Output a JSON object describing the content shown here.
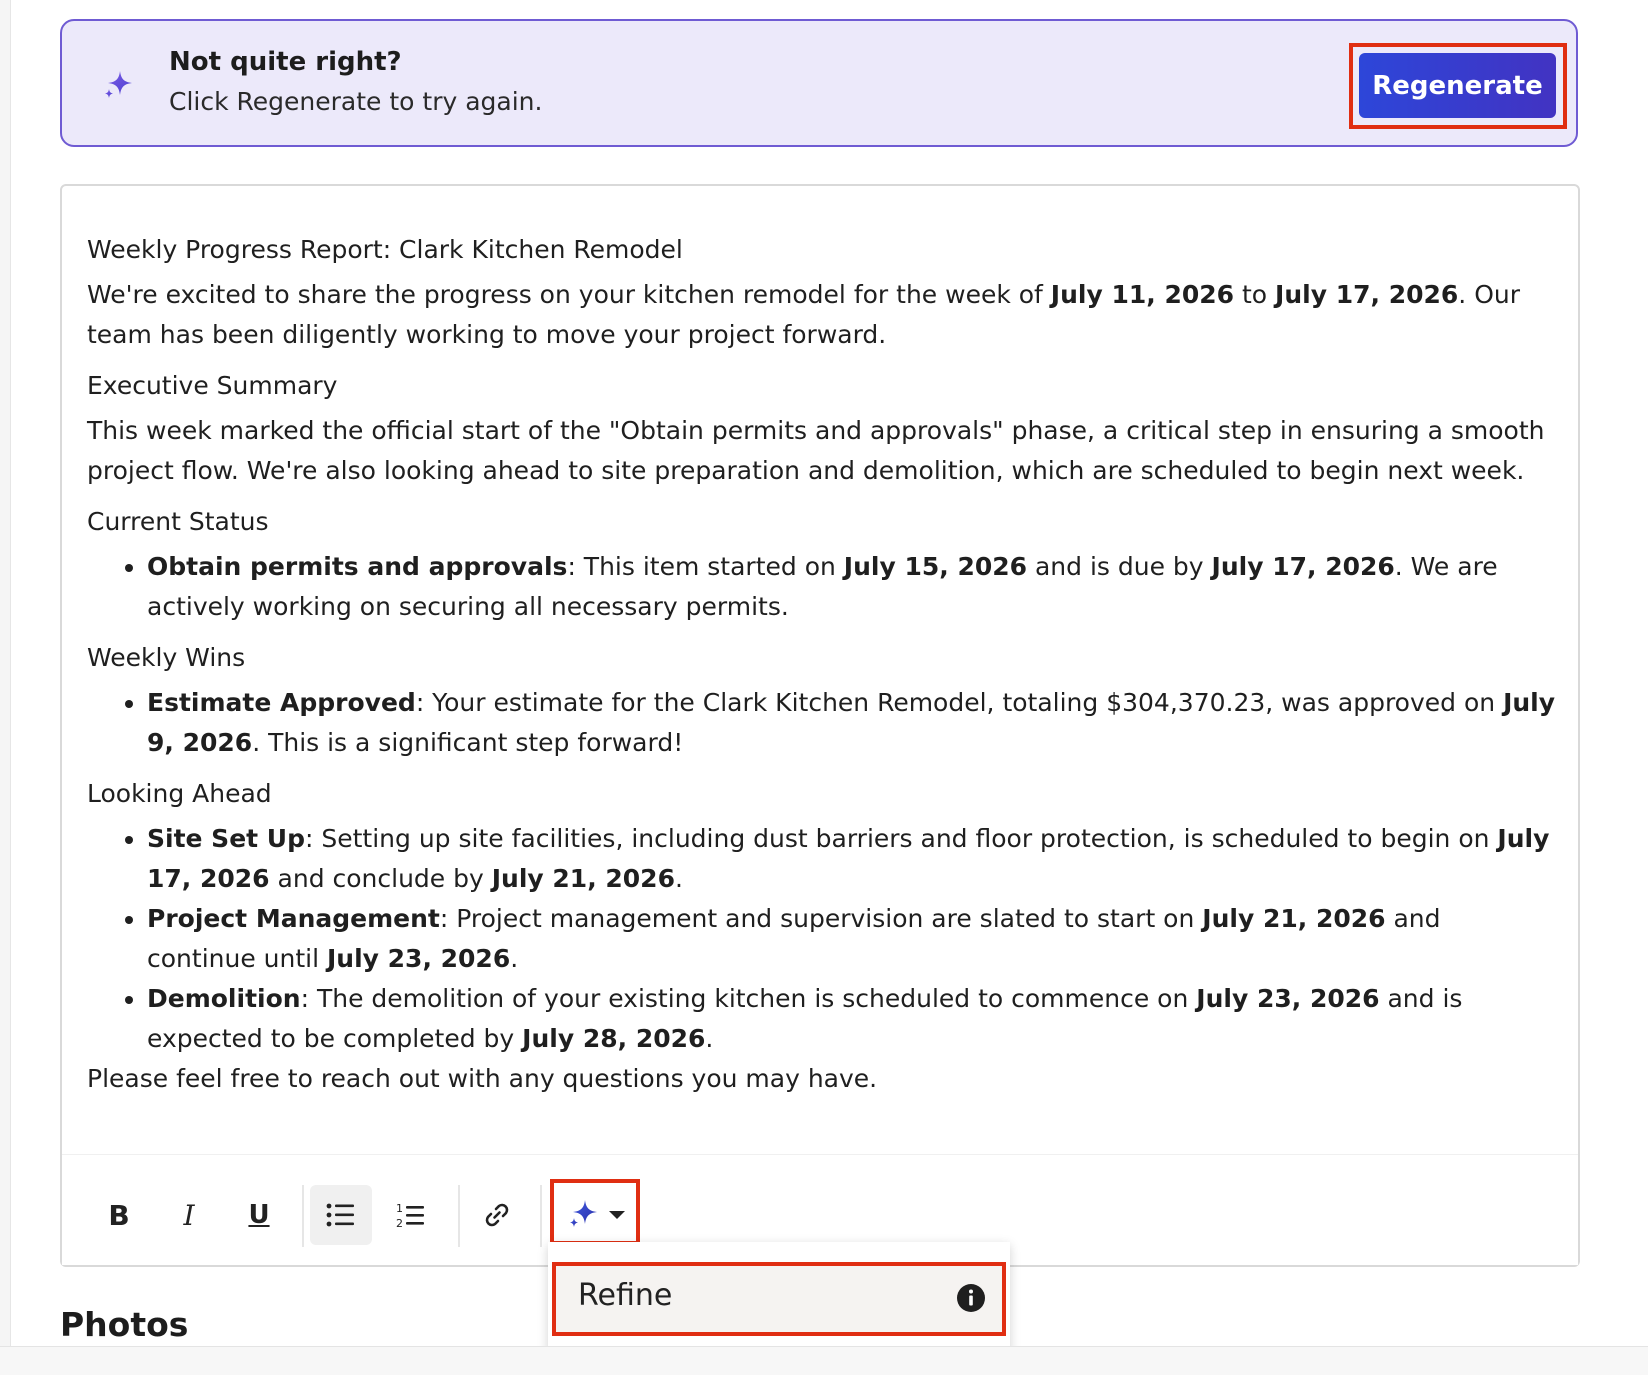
{
  "banner": {
    "title": "Not quite right?",
    "subtitle": "Click Regenerate to try again.",
    "regenerate_label": "Regenerate",
    "icon": "sparkle-icon"
  },
  "report": {
    "title": "Weekly Progress Report: Clark Kitchen Remodel",
    "intro": {
      "p1": "We're excited to share the progress on your kitchen remodel for the week of ",
      "date_start": "July 11, 2026",
      "p2": " to ",
      "date_end": "July 17, 2026",
      "p3": ". Our team has been diligently working to move your project forward."
    },
    "exec_summary": {
      "heading": "Executive Summary",
      "text": "This week marked the official start of the \"Obtain permits and approvals\" phase, a critical step in ensuring a smooth project flow. We're also looking ahead to site preparation and demolition, which are scheduled to begin next week."
    },
    "current_status": {
      "heading": "Current Status",
      "item": {
        "label": "Obtain permits and approvals",
        "t1": ": This item started on ",
        "d1": "July 15, 2026",
        "t2": " and is due by ",
        "d2": "July 17, 2026",
        "t3": ". We are actively working on securing all necessary permits."
      }
    },
    "weekly_wins": {
      "heading": "Weekly Wins",
      "item": {
        "label": "Estimate Approved",
        "t1": ": Your estimate for the Clark Kitchen Remodel, totaling $304,370.23, was approved on ",
        "d1": "July 9, 2026",
        "t2": ". This is a significant step forward!"
      }
    },
    "looking_ahead": {
      "heading": "Looking Ahead",
      "item1": {
        "label": "Site Set Up",
        "t1": ": Setting up site facilities, including dust barriers and floor protection, is scheduled to begin on ",
        "d1": "July 17, 2026",
        "t2": " and conclude by ",
        "d2": "July 21, 2026",
        "t3": "."
      },
      "item2": {
        "label": "Project Management",
        "t1": ": Project management and supervision are slated to start on ",
        "d1": "July 21, 2026",
        "t2": " and continue until ",
        "d2": "July 23, 2026",
        "t3": "."
      },
      "item3": {
        "label": "Demolition",
        "t1": ": The demolition of your existing kitchen is scheduled to commence on ",
        "d1": "July 23, 2026",
        "t2": " and is expected to be completed by ",
        "d2": "July 28, 2026",
        "t3": "."
      }
    },
    "closing": "Please feel free to reach out with any questions you may have."
  },
  "toolbar": {
    "bold_label": "B",
    "italic_label": "I",
    "underline_label": "U",
    "icons": [
      "bold-icon",
      "italic-icon",
      "underline-icon",
      "bulleted-list-icon",
      "numbered-list-icon",
      "link-icon",
      "ai-sparkle-icon",
      "caret-down-icon"
    ]
  },
  "dropdown": {
    "refine_label": "Refine",
    "icon": "info-icon"
  },
  "section": {
    "photos_heading": "Photos"
  },
  "colors": {
    "banner_bg": "#ece9fa",
    "banner_border": "#6f5bd3",
    "accent_blue": "#2d46d9",
    "highlight_red": "#e02e12"
  }
}
